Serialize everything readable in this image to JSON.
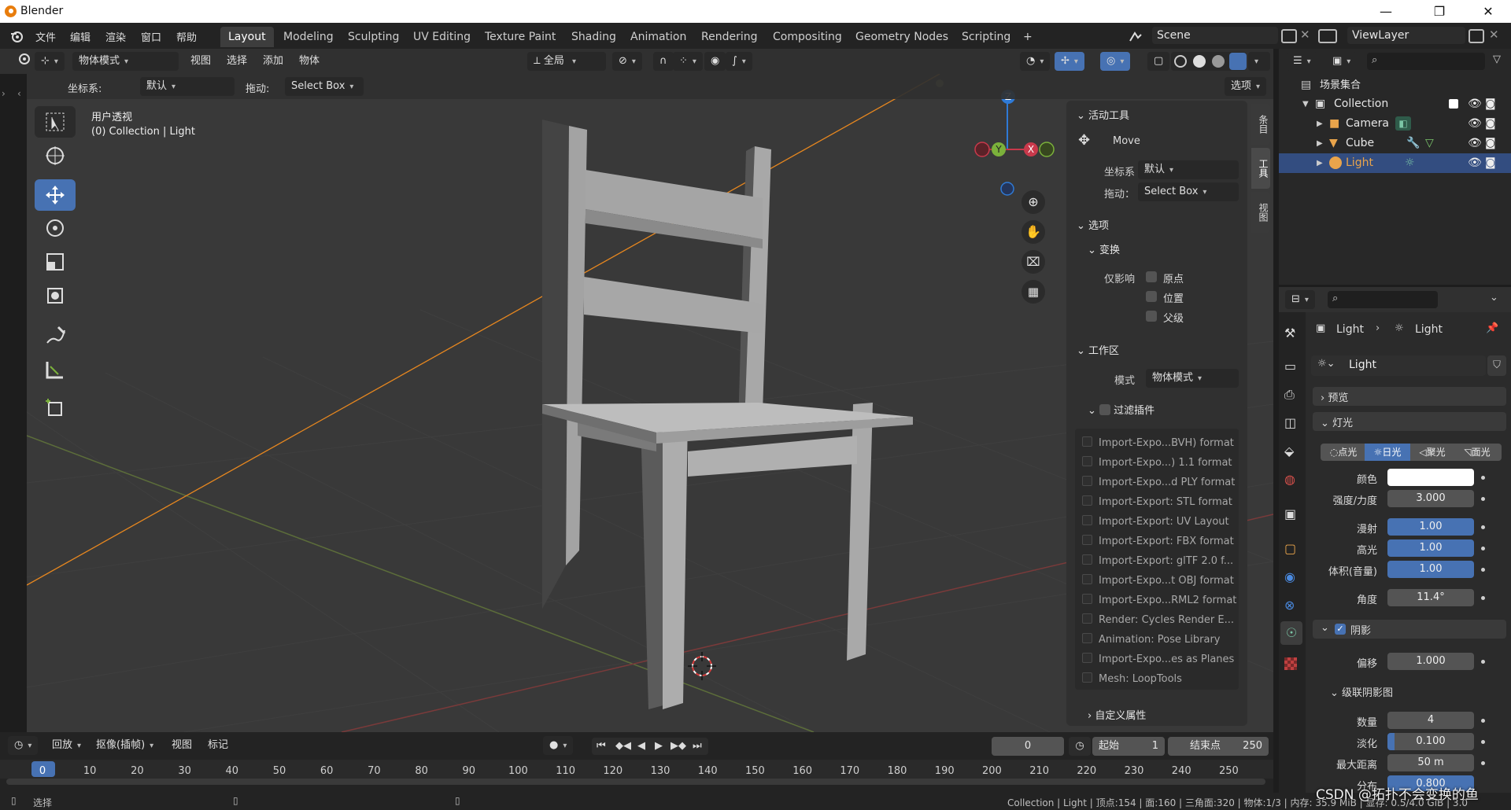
{
  "window": {
    "title": "Blender",
    "min": "—",
    "max": "❐",
    "close": "✕"
  },
  "menu": {
    "file": "文件",
    "edit": "编辑",
    "render": "渲染",
    "window": "窗口",
    "help": "帮助"
  },
  "workspaces": [
    "Layout",
    "Modeling",
    "Sculpting",
    "UV Editing",
    "Texture Paint",
    "Shading",
    "Animation",
    "Rendering",
    "Compositing",
    "Geometry Nodes",
    "Scripting",
    "+"
  ],
  "scene": {
    "name": "Scene",
    "view_layer": "ViewLayer"
  },
  "header3d": {
    "mode": "物体模式",
    "view": "视图",
    "select": "选择",
    "add": "添加",
    "object": "物体",
    "transform_orientation": "全局"
  },
  "toolrow": {
    "coord_label": "坐标系:",
    "coord_value": "默认",
    "drag_label": "拖动:",
    "drag_value": "Select Box",
    "options": "选项"
  },
  "viewport": {
    "view_name": "用户透视",
    "collection_info": "(0) Collection | Light"
  },
  "gizmo": {
    "z": "Z",
    "y": "Y",
    "x": "X"
  },
  "npanel": {
    "tabs": [
      "条目",
      "工具",
      "视图"
    ],
    "active_tool": "活动工具",
    "tool_name": "Move",
    "coord_label": "坐标系",
    "coord_value": "默认",
    "drag_label": "拖动：",
    "drag_value": "Select Box",
    "options": "选项",
    "transform": "变换",
    "affect_only": "仅影响",
    "origins": "原点",
    "locations": "位置",
    "parents": "父级",
    "workspace": "工作区",
    "mode_label": "模式",
    "mode_value": "物体模式",
    "filter_addons": "过滤插件",
    "addons": [
      "Import-Expo...BVH) format",
      "Import-Expo...) 1.1 format",
      "Import-Expo...d PLY format",
      "Import-Export: STL format",
      "Import-Export: UV Layout",
      "Import-Export: FBX format",
      "Import-Export: glTF 2.0 f...",
      "Import-Expo...t OBJ format",
      "Import-Expo...RML2 format",
      "Render: Cycles Render E...",
      "Animation: Pose Library",
      "Import-Expo...es as Planes",
      "Mesh: LoopTools"
    ],
    "custom_props": "自定义属性"
  },
  "outliner": {
    "root": "场景集合",
    "collection": "Collection",
    "items": [
      "Camera",
      "Cube",
      "Light"
    ]
  },
  "props": {
    "breadcrumb_obj": "Light",
    "breadcrumb_data": "Light",
    "datablock": "Light",
    "preview": "预览",
    "light": "灯光",
    "types": [
      "点光",
      "日光",
      "聚光",
      "面光"
    ],
    "color_label": "颜色",
    "strength_label": "强度/力度",
    "strength": "3.000",
    "diffuse_label": "漫射",
    "diffuse": "1.00",
    "specular_label": "高光",
    "specular": "1.00",
    "volume_label": "体积(音量)",
    "volume": "1.00",
    "angle_label": "角度",
    "angle": "11.4°",
    "shadow": "阴影",
    "bias_label": "偏移",
    "bias": "1.000",
    "cascade": "级联阴影图",
    "count_label": "数量",
    "count": "4",
    "fade_label": "淡化",
    "fade": "0.100",
    "maxdist_label": "最大距离",
    "maxdist": "50 m",
    "distribution_label": "分布",
    "distribution": "0.800"
  },
  "timeline": {
    "playback": "回放",
    "keying": "抠像(插帧)",
    "view": "视图",
    "marker": "标记",
    "current_frame": "0",
    "start_label": "起始",
    "start": "1",
    "end_label": "结束点",
    "end": "250",
    "ruler": [
      "0",
      "10",
      "20",
      "30",
      "40",
      "50",
      "60",
      "70",
      "80",
      "90",
      "100",
      "110",
      "120",
      "130",
      "140",
      "150",
      "160",
      "170",
      "180",
      "190",
      "200",
      "210",
      "220",
      "230",
      "240",
      "250"
    ]
  },
  "status": {
    "select": "选择",
    "info": "Collection | Light | 顶点:154 | 面:160 | 三角面:320 | 物体:1/3 | 内存: 35.9 MiB | 显存: 0.5/4.0 GiB | 3.0",
    "watermark": "CSDN @拓扑不会变换的鱼"
  },
  "colors": {
    "accent": "#4772b3",
    "active_object": "#e9a44b",
    "x_axis": "#c8394b",
    "y_axis": "#7bb13b",
    "z_axis": "#2f7ad6"
  }
}
